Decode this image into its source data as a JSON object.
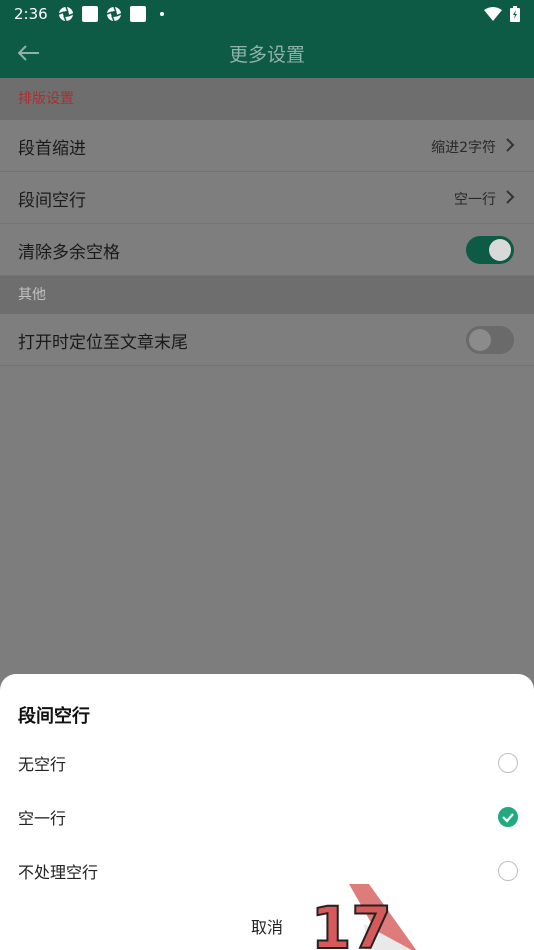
{
  "status_bar": {
    "time": "2:36"
  },
  "app_bar": {
    "title": "更多设置"
  },
  "sections": {
    "layout": {
      "header": "排版设置",
      "indent": {
        "label": "段首缩进",
        "value": "缩进2字符"
      },
      "spacing": {
        "label": "段间空行",
        "value": "空一行"
      },
      "trim": {
        "label": "清除多余空格",
        "checked": true
      }
    },
    "other": {
      "header": "其他",
      "locate_end": {
        "label": "打开时定位至文章末尾",
        "checked": false
      }
    }
  },
  "sheet": {
    "title": "段间空行",
    "options": [
      {
        "label": "无空行",
        "selected": false
      },
      {
        "label": "空一行",
        "selected": true
      },
      {
        "label": "不处理空行",
        "selected": false
      }
    ],
    "cancel": "取消"
  },
  "watermark": {
    "label": "17"
  },
  "colors": {
    "primary": "#0d5a45",
    "accent": "#22a97f",
    "section_red": "#a53232"
  }
}
